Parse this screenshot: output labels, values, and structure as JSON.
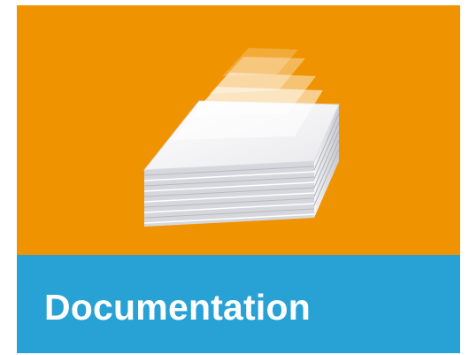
{
  "tile": {
    "label": "Documentation",
    "icon": "document-stack-icon",
    "colors": {
      "image_background": "#ef9300",
      "caption_background": "#28a1d5",
      "caption_text": "#ffffff"
    }
  }
}
